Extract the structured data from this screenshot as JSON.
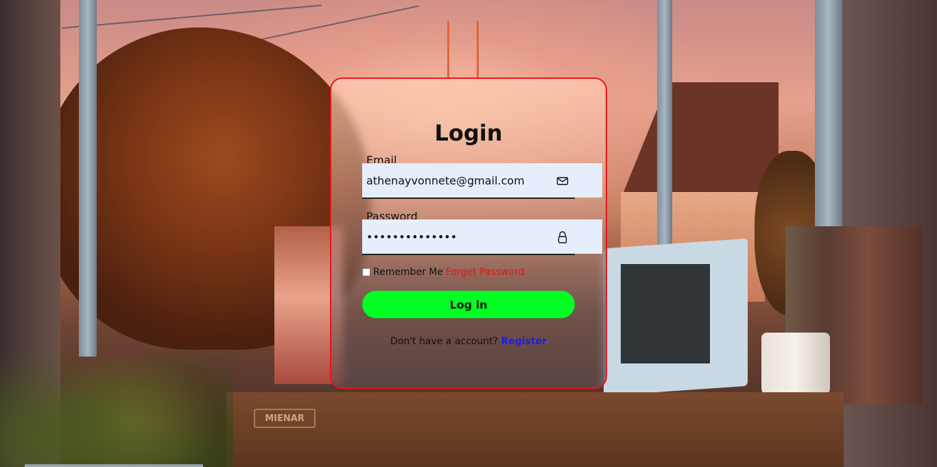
{
  "login": {
    "title": "Login",
    "email_label": "Email",
    "email_value": "athenayvonnete@gmail.com",
    "email_icon": "envelope-icon",
    "password_label": "Password",
    "password_value": "••••••••••••••",
    "password_icon": "lock-icon",
    "remember_label": "Remember Me",
    "forget_label": "Forget Password",
    "login_button": "Log in",
    "no_account_text": "Don't have a account?",
    "register_link": "Register"
  },
  "scene": {
    "desk_plate": "MIENAR"
  },
  "colors": {
    "card_border": "#e8141a",
    "button_bg": "#00ff22",
    "forget_link": "#e01818",
    "register_link": "#1a1aff",
    "field_bg": "#e6eefc"
  }
}
